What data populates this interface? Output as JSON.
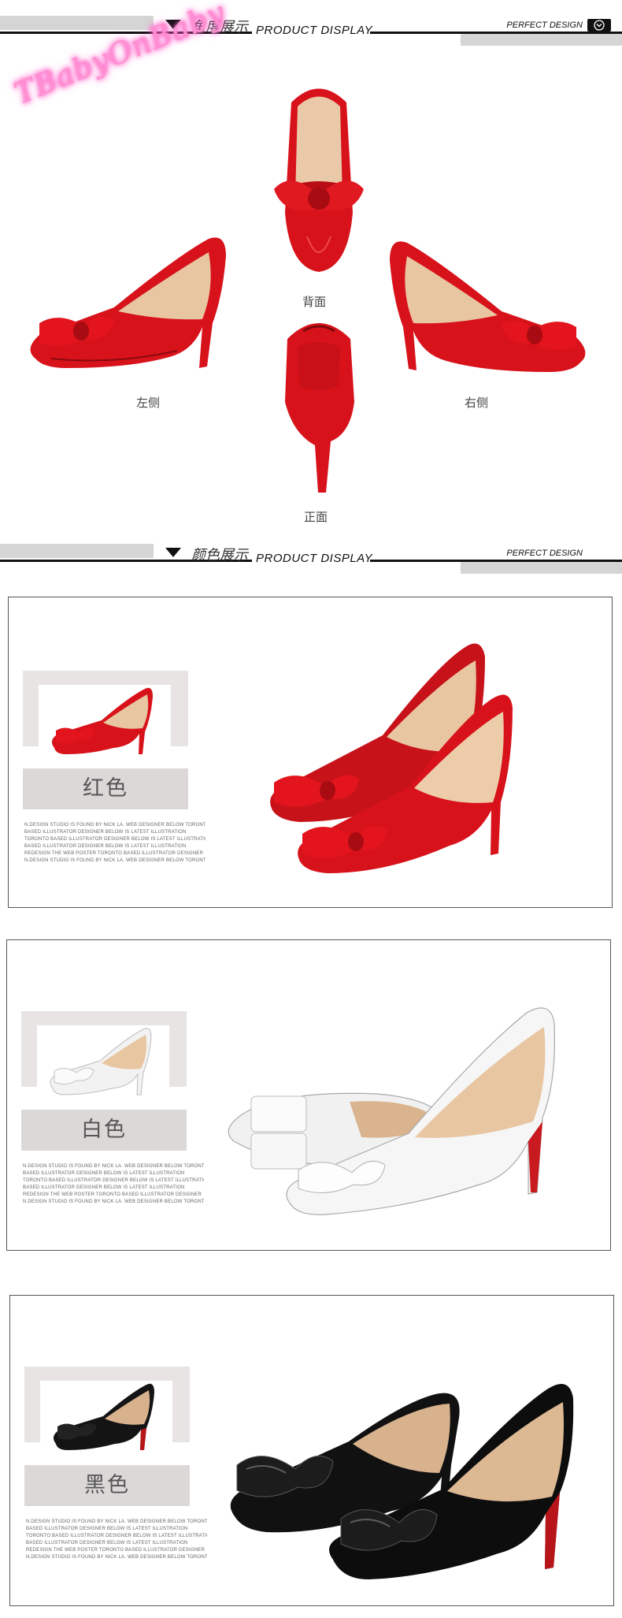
{
  "brand": {
    "logo_text": "TBabyOnBaby"
  },
  "section_angle": {
    "cn_title": "角度展示",
    "en_title": "PRODUCT DISPLAY",
    "design_label": "PERFECT DESIGN",
    "views": {
      "back": "背面",
      "left": "左侧",
      "right": "右侧",
      "front": "正面"
    }
  },
  "section_color": {
    "cn_title": "颜色展示",
    "en_title": "PRODUCT DISPLAY",
    "design_label": "PERFECT DESIGN"
  },
  "colors": [
    {
      "name": "红色",
      "hex": "#d8121b"
    },
    {
      "name": "白色",
      "hex": "#f6f6f6"
    },
    {
      "name": "黑色",
      "hex": "#141414"
    }
  ],
  "description_lines": [
    "N.DESIGN STUDIO IS FOUND BY NICK LA. WEB DESIGNER BELOW TORONTO",
    "BASED ILLUSTRATOR DESIGNER BELOW IS LATEST ILLUSTRATION",
    "TORONTO BASED ILLUSTRATOR DESIGNER BELOW IS LATEST ILLUSTRATION",
    "BASED ILLUSTRATOR DESIGNER BELOW IS LATEST ILLUSTRATION",
    "REDESIGN THE WEB POSTER TORONTO BASED ILLUSTRATOR DESIGNER",
    "N.DESIGN STUDIO IS FOUND BY NICK LA. WEB DESIGNER BELOW TORONTO"
  ],
  "icons": {
    "header_button": "chevron-down-icon"
  }
}
